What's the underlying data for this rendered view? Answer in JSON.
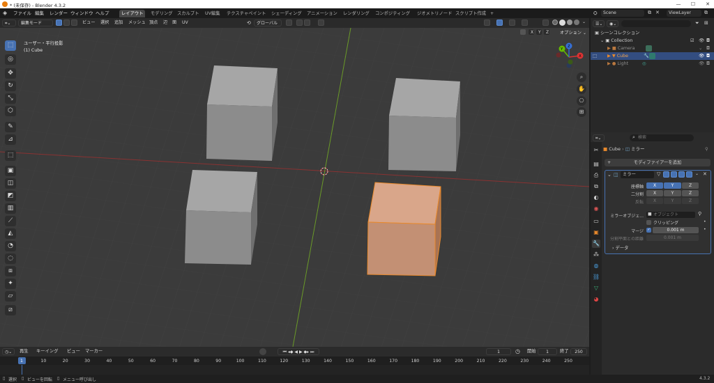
{
  "window": {
    "title": "* (未保存) - Blender 4.3.2",
    "minimize": "—",
    "maximize": "☐",
    "close": "✕"
  },
  "menu": [
    "ファイル",
    "編集",
    "レンダー",
    "ウィンドウ",
    "ヘルプ"
  ],
  "workspaces": [
    {
      "label": "レイアウト",
      "active": true
    },
    {
      "label": "モデリング"
    },
    {
      "label": "スカルプト"
    },
    {
      "label": "UV編集"
    },
    {
      "label": "テクスチャペイント"
    },
    {
      "label": "シェーディング"
    },
    {
      "label": "アニメーション"
    },
    {
      "label": "レンダリング"
    },
    {
      "label": "コンポジティング"
    },
    {
      "label": "ジオメトリノード"
    },
    {
      "label": "スクリプト作成"
    },
    {
      "label": "+"
    }
  ],
  "scene": {
    "name": "Scene",
    "viewlayer": "ViewLayer"
  },
  "header3d": {
    "mode": "編集モード",
    "menus": [
      "ビュー",
      "選択",
      "追加",
      "メッシュ",
      "頂点",
      "辺",
      "面",
      "UV"
    ],
    "orientation": "グローバル",
    "axes": [
      "X",
      "Y",
      "Z"
    ],
    "options": "オプション ⌄"
  },
  "viewport": {
    "view_name": "ユーザー・平行投影",
    "object_name": "(1) Cube",
    "gizmo": {
      "x": "X",
      "y": "Y",
      "z": "Z"
    }
  },
  "toolbar_icons": [
    "select-box-icon",
    "cursor-icon",
    "move-icon",
    "rotate-icon",
    "scale-icon",
    "transform-icon",
    "annotate-icon",
    "measure-icon",
    "add-cube-icon",
    "extrude-icon",
    "inset-icon",
    "bevel-icon",
    "loopcut-icon",
    "knife-icon",
    "polybuild-icon",
    "spin-icon",
    "smooth-icon",
    "edge-slide-icon",
    "shrink-icon",
    "shear-icon",
    "rip-icon"
  ],
  "timeline": {
    "menus": [
      "再生",
      "キーイング",
      "ビュー",
      "マーカー"
    ],
    "current_frame": "1",
    "start_label": "開始",
    "start": "1",
    "end_label": "終了",
    "end": "250",
    "ticks": [
      "1",
      "10",
      "20",
      "30",
      "40",
      "50",
      "60",
      "70",
      "80",
      "90",
      "100",
      "110",
      "120",
      "130",
      "140",
      "150",
      "160",
      "170",
      "180",
      "190",
      "200",
      "210",
      "220",
      "230",
      "240",
      "250"
    ]
  },
  "status": {
    "select": "選択",
    "rotate": "ビューを回転",
    "menu": "メニュー呼び出し",
    "version": "4.3.2"
  },
  "outliner": {
    "root": "シーンコレクション",
    "items": [
      {
        "name": "Collection"
      },
      {
        "name": "Camera"
      },
      {
        "name": "Cube"
      },
      {
        "name": "Light"
      }
    ]
  },
  "properties": {
    "search_placeholder": "検索",
    "breadcrumb_object": "Cube",
    "breadcrumb_modifier": "ミラー",
    "add_modifier": "モディファイアーを追加",
    "modifier_name": "ミラー",
    "axis_label": "座標軸",
    "bisect_label": "二分割",
    "flip_label": "反転",
    "xyz": [
      "X",
      "Y",
      "Z"
    ],
    "mirror_object_label": "ミラーオブジェ...",
    "mirror_object_placeholder": "オブジェクト",
    "clipping_label": "クリッピング",
    "merge_label": "マージ",
    "merge_value": "0.001 m",
    "bisect_distance_label": "分割平面との距離",
    "bisect_distance_value": "0.001 m",
    "data_label": "データ"
  },
  "colors": {
    "accent": "#4772b3",
    "selected_orange": "#e8892c",
    "x_axis": "#9a3a3a",
    "y_axis": "#6f9a2c"
  }
}
